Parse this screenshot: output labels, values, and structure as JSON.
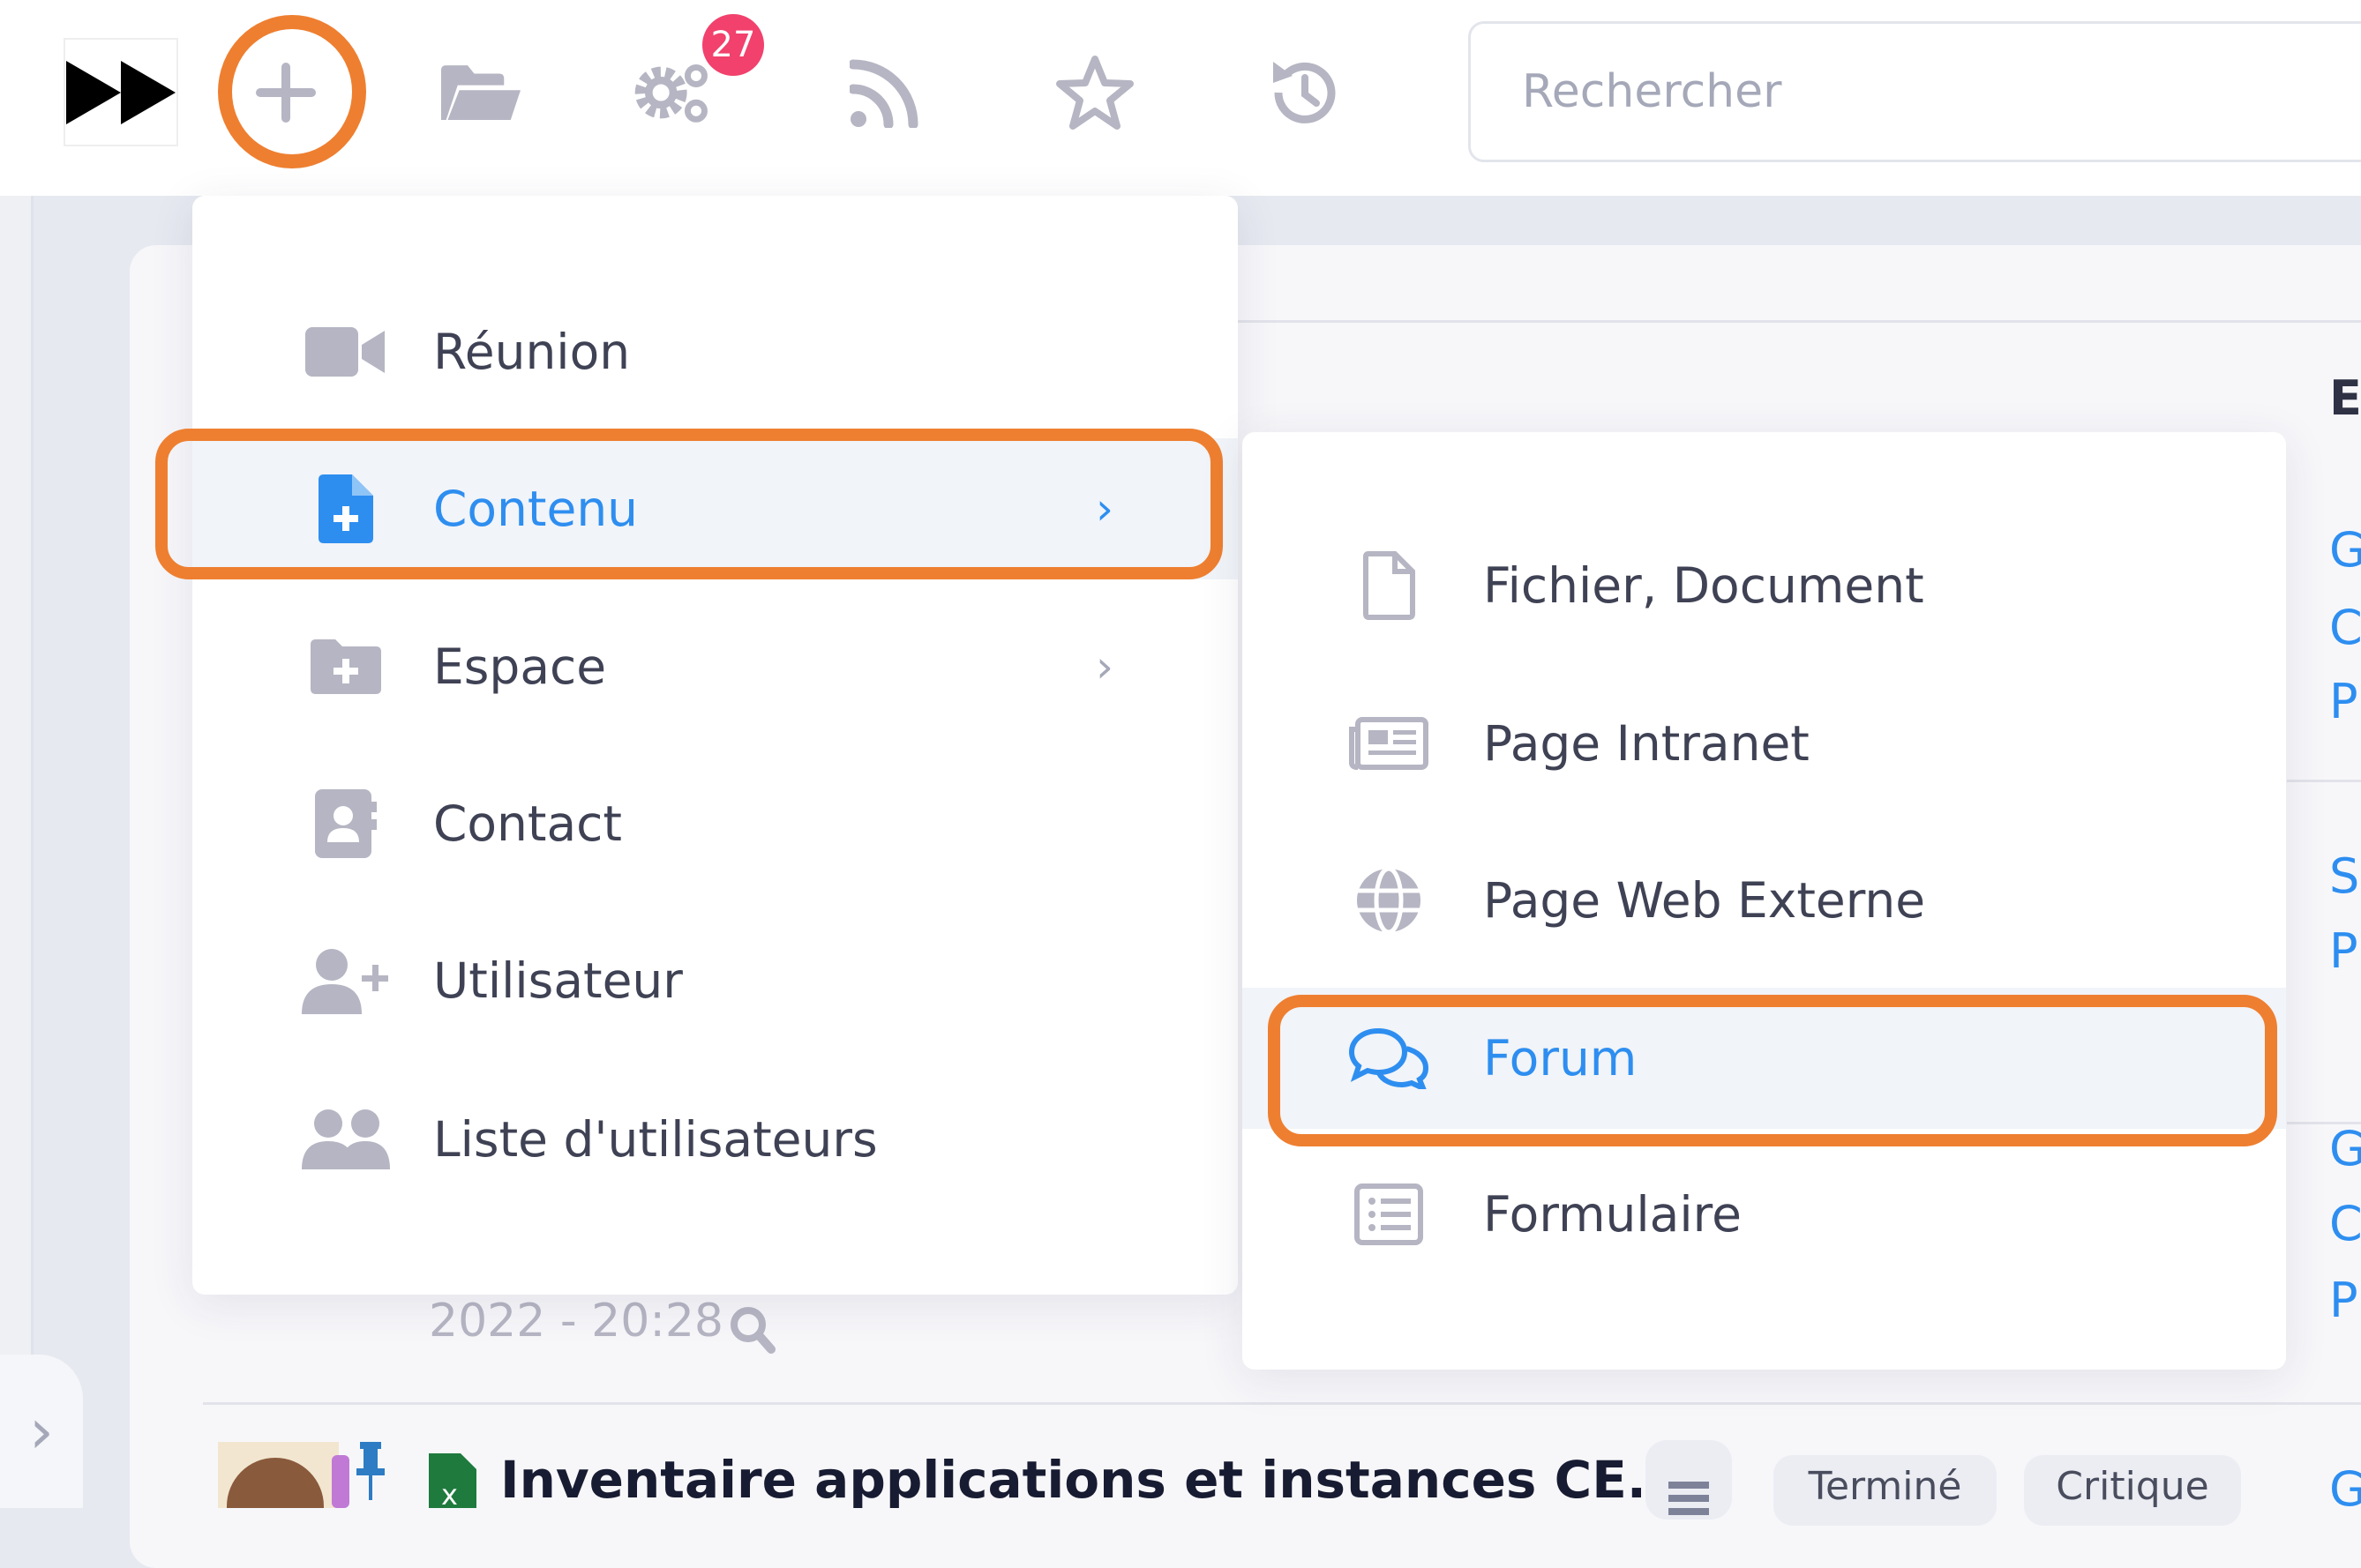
{
  "topbar": {
    "badge_count": "27",
    "search_placeholder": "Rechercher",
    "icons": [
      "fast-forward-logo",
      "plus-icon",
      "folder-open-icon",
      "gears-icon",
      "rss-icon",
      "star-icon",
      "history-icon"
    ]
  },
  "menu": {
    "items": [
      {
        "label": "Réunion",
        "icon": "video-icon"
      },
      {
        "label": "Contenu",
        "icon": "file-plus-icon",
        "has_submenu": true,
        "active": true
      },
      {
        "label": "Espace",
        "icon": "folder-plus-icon",
        "has_submenu": true
      },
      {
        "label": "Contact",
        "icon": "address-book-icon"
      },
      {
        "label": "Utilisateur",
        "icon": "user-plus-icon"
      },
      {
        "label": "Liste d'utilisateurs",
        "icon": "users-icon"
      }
    ]
  },
  "submenu": {
    "items": [
      {
        "label": "Fichier, Document",
        "icon": "file-icon"
      },
      {
        "label": "Page Intranet",
        "icon": "newspaper-icon"
      },
      {
        "label": "Page Web Externe",
        "icon": "globe-icon"
      },
      {
        "label": "Forum",
        "icon": "comments-icon",
        "active": true
      },
      {
        "label": "Formulaire",
        "icon": "list-form-icon"
      }
    ]
  },
  "background": {
    "column_header": "Es",
    "letters": [
      "G",
      "C",
      "P",
      "S",
      "P",
      "G",
      "C",
      "P",
      "G"
    ],
    "timestamp": "2022 - 20:28",
    "row_title": "Inventaire applications et instances CE...",
    "tags": [
      "Terminé",
      "Critique"
    ]
  },
  "colors": {
    "accent": "#2e8ef0",
    "highlight": "#ee7f30",
    "badge": "#f1416c",
    "icon_gray": "#b5b5c3"
  }
}
